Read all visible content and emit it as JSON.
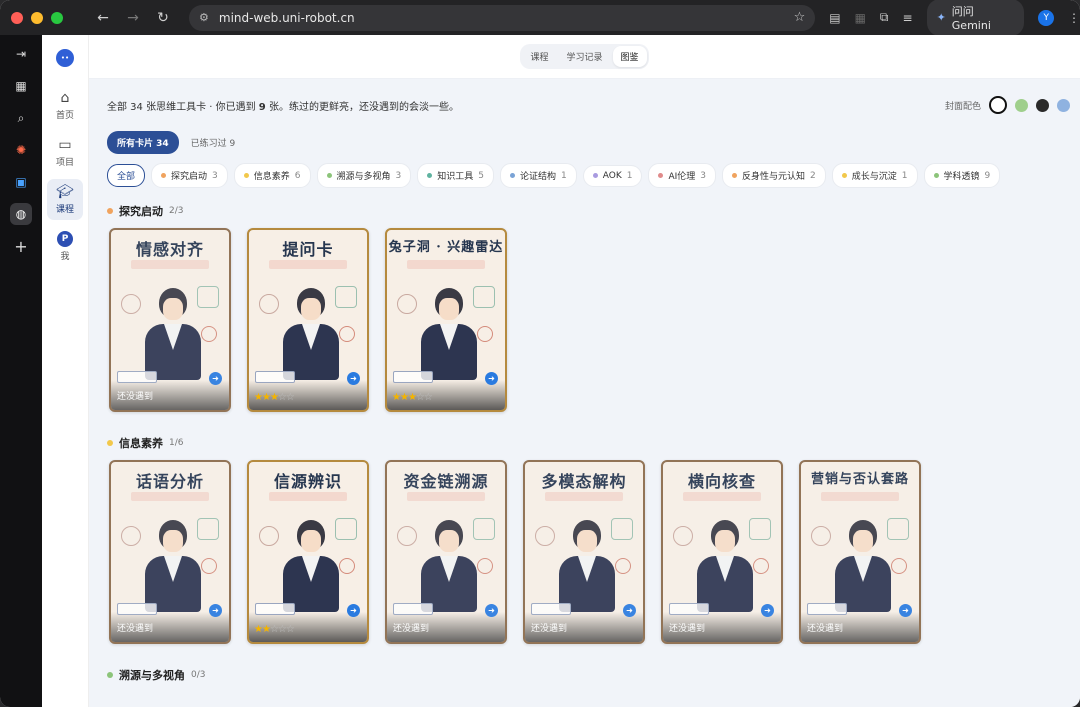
{
  "browser": {
    "url": "mind-web.uni-robot.cn",
    "gemini_label": "问问 Gemini",
    "profile_initial": "Y"
  },
  "sidebar": {
    "items": [
      {
        "label": "首页",
        "icon": "home-icon"
      },
      {
        "label": "项目",
        "icon": "folder-icon"
      },
      {
        "label": "课程",
        "icon": "graduation-cap-icon",
        "active": true
      },
      {
        "label": "我",
        "icon": "profile-avatar",
        "initial": "P"
      }
    ]
  },
  "topbar": {
    "tabs": [
      "课程",
      "学习记录",
      "图鉴"
    ],
    "active_tab": "图鉴"
  },
  "summary": {
    "text_prefix": "全部 34 张思维工具卡 · 你已遇到 ",
    "count": "9",
    "text_suffix": " 张。练过的更鲜亮，还没遇到的会淡一些。",
    "cover_label": "封面配色",
    "cover_colors": [
      "#ffffff",
      "#9fcf8c",
      "#2a2a2a",
      "#8fb2e0"
    ]
  },
  "view_tabs": {
    "all": "所有卡片 34",
    "practiced": "已练习过 9"
  },
  "filters": [
    {
      "label": "全部",
      "count": "",
      "color": ""
    },
    {
      "label": "探究启动",
      "count": "3",
      "color": "#f0a35e"
    },
    {
      "label": "信息素养",
      "count": "6",
      "color": "#f2c84b"
    },
    {
      "label": "溯源与多视角",
      "count": "3",
      "color": "#8cc47a"
    },
    {
      "label": "知识工具",
      "count": "5",
      "color": "#5fb3a0"
    },
    {
      "label": "论证结构",
      "count": "1",
      "color": "#7aa3d6"
    },
    {
      "label": "AOK",
      "count": "1",
      "color": "#a99be0"
    },
    {
      "label": "AI伦理",
      "count": "3",
      "color": "#e08b8b"
    },
    {
      "label": "反身性与元认知",
      "count": "2",
      "color": "#f0a35e"
    },
    {
      "label": "成长与沉淀",
      "count": "1",
      "color": "#f2c84b"
    },
    {
      "label": "学科透镜",
      "count": "9",
      "color": "#8cc47a"
    }
  ],
  "sections": [
    {
      "title": "探究启动",
      "count": "2/3",
      "color": "#f0a35e",
      "cards": [
        {
          "title": "情感对齐",
          "status": "还没遇到",
          "stars": 0
        },
        {
          "title": "提问卡",
          "status": "",
          "stars": 3
        },
        {
          "title": "兔子洞 · 兴趣雷达",
          "status": "",
          "stars": 3
        }
      ]
    },
    {
      "title": "信息素养",
      "count": "1/6",
      "color": "#f2c84b",
      "cards": [
        {
          "title": "话语分析",
          "status": "还没遇到",
          "stars": 0
        },
        {
          "title": "信源辨识",
          "status": "",
          "stars": 2
        },
        {
          "title": "资金链溯源",
          "status": "还没遇到",
          "stars": 0
        },
        {
          "title": "多模态解构",
          "status": "还没遇到",
          "stars": 0
        },
        {
          "title": "横向核查",
          "status": "还没遇到",
          "stars": 0
        },
        {
          "title": "营销与否认套路",
          "status": "还没遇到",
          "stars": 0
        }
      ]
    },
    {
      "title": "溯源与多视角",
      "count": "0/3",
      "color": "#8cc47a",
      "cards": []
    }
  ]
}
